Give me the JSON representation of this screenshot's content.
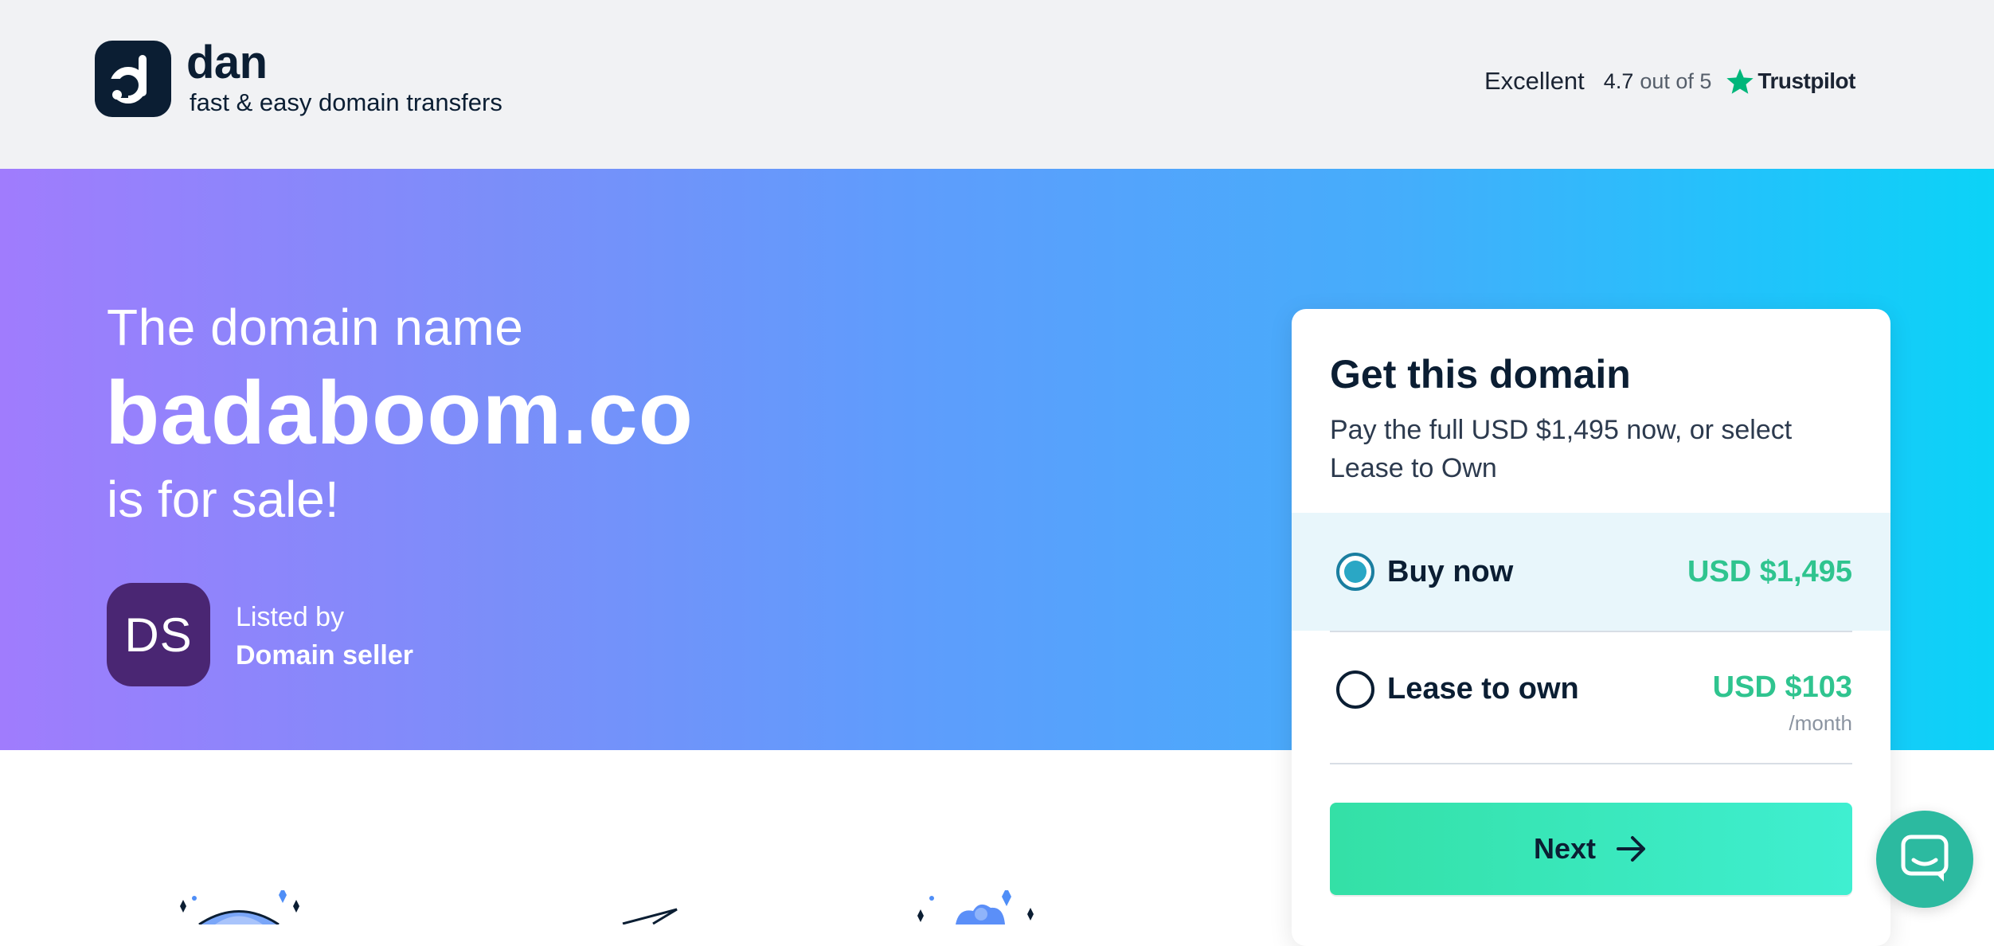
{
  "header": {
    "brand_name": "dan",
    "tagline": "fast & easy domain transfers",
    "rating": {
      "word": "Excellent",
      "score": "4.7",
      "out_of": "out of 5",
      "provider": "Trustpilot"
    }
  },
  "hero": {
    "pre_text": "The domain name",
    "domain": "badaboom.co",
    "post_text": "is for sale!",
    "seller": {
      "initials": "DS",
      "listed_by": "Listed by",
      "name": "Domain seller"
    }
  },
  "card": {
    "title": "Get this domain",
    "description": "Pay the full USD $1,495 now, or select Lease to Own",
    "options": [
      {
        "label": "Buy now",
        "price": "USD $1,495",
        "selected": true
      },
      {
        "label": "Lease to own",
        "price": "USD $103",
        "sub": "/month",
        "selected": false
      }
    ],
    "next_label": "Next"
  },
  "colors": {
    "brand_dark": "#0b1e33",
    "price_green": "#2fc48f",
    "trustpilot_green": "#00b67a",
    "chat_teal": "#2cbaa0",
    "avatar_purple": "#4a2673"
  },
  "icons": {
    "logo": "dan-logo-icon",
    "trustpilot": "star-icon",
    "next": "arrow-right-icon",
    "chat": "chat-icon"
  }
}
